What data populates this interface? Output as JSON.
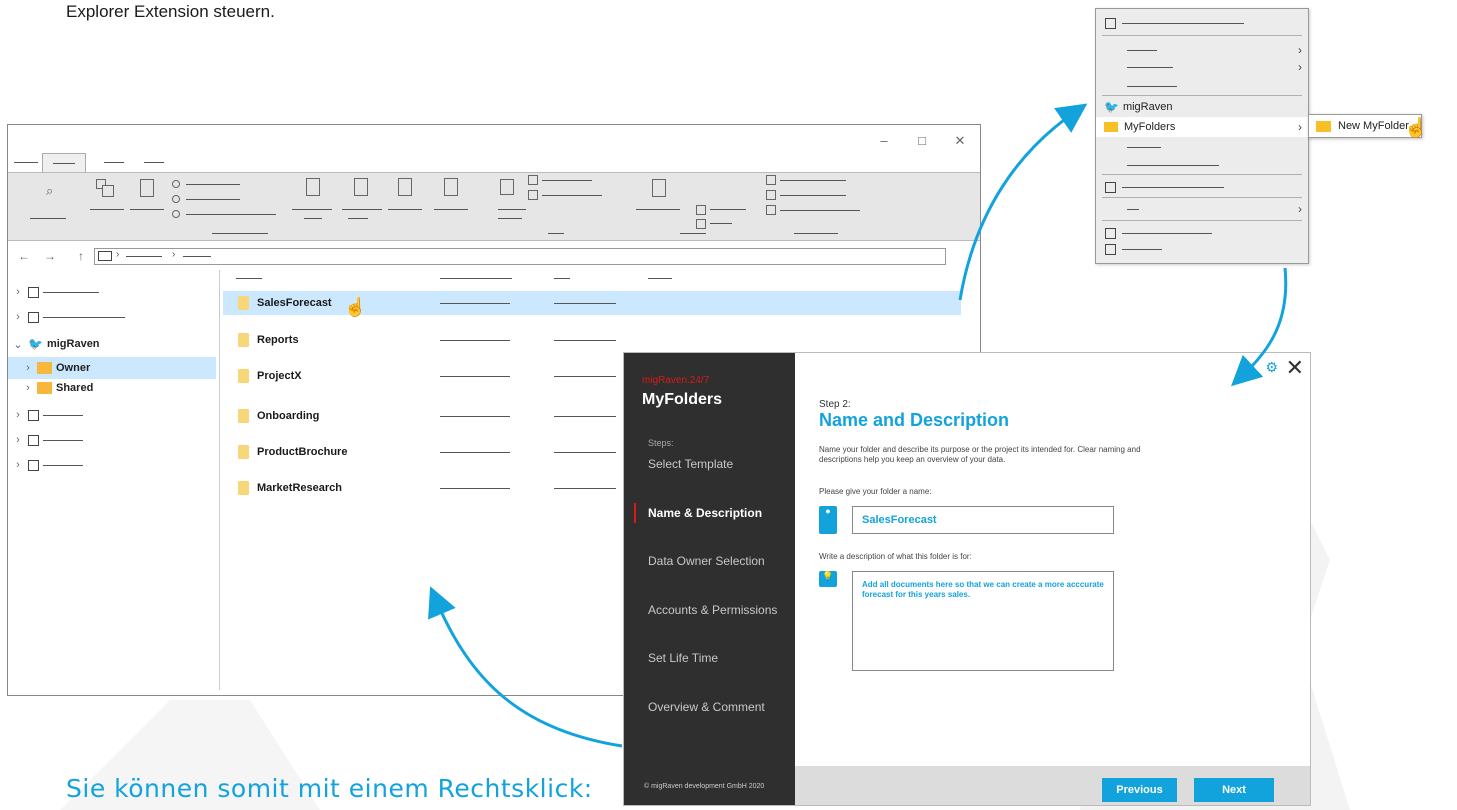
{
  "intro_text": "Explorer Extension steuern.",
  "claim": "Sie können somit mit einem Rechtsklick:",
  "explorer": {
    "nav_tree": [
      {
        "label": "",
        "state": "collapsed"
      },
      {
        "label": "",
        "state": "collapsed"
      },
      {
        "label": "migRaven",
        "state": "expanded"
      },
      {
        "label": "Owner",
        "state": "selected"
      },
      {
        "label": "Shared",
        "state": "collapsed"
      },
      {
        "label": "",
        "state": "collapsed"
      },
      {
        "label": "",
        "state": "collapsed"
      },
      {
        "label": "",
        "state": "collapsed"
      }
    ],
    "files": [
      "SalesForecast",
      "Reports",
      "ProjectX",
      "Onboarding",
      "ProductBrochure",
      "MarketResearch"
    ],
    "selected_file": "SalesForecast"
  },
  "context_menu": {
    "brand_item": "migRaven",
    "highlighted_item": "MyFolders",
    "submenu_item": "New MyFolder"
  },
  "wizard": {
    "brand": "migRaven.24/7",
    "title": "MyFolders",
    "steps_label": "Steps:",
    "steps": [
      "Select Template",
      "Name & Description",
      "Data Owner Selection",
      "Accounts & Permissions",
      "Set Life Time",
      "Overview & Comment"
    ],
    "active_step": "Name & Description",
    "copyright": "© migRaven development GmbH 2020",
    "step_number": "Step 2:",
    "heading": "Name and Description",
    "description": "Name your folder and describe its purpose or the project its intended for. Clear naming and descriptions help you keep an overview of your data.",
    "name_label": "Please give your folder a name:",
    "name_value": "SalesForecast",
    "desc_label": "Write a description of what this folder is for:",
    "desc_value": "Add all documents here so that we can create a more acccurate forecast for this years sales.",
    "previous_label": "Previous",
    "next_label": "Next"
  },
  "colors": {
    "accent": "#13a3dc",
    "sidebar": "#2f2f2f",
    "brand_red": "#d51a1a",
    "selection": "#cce8ff"
  }
}
